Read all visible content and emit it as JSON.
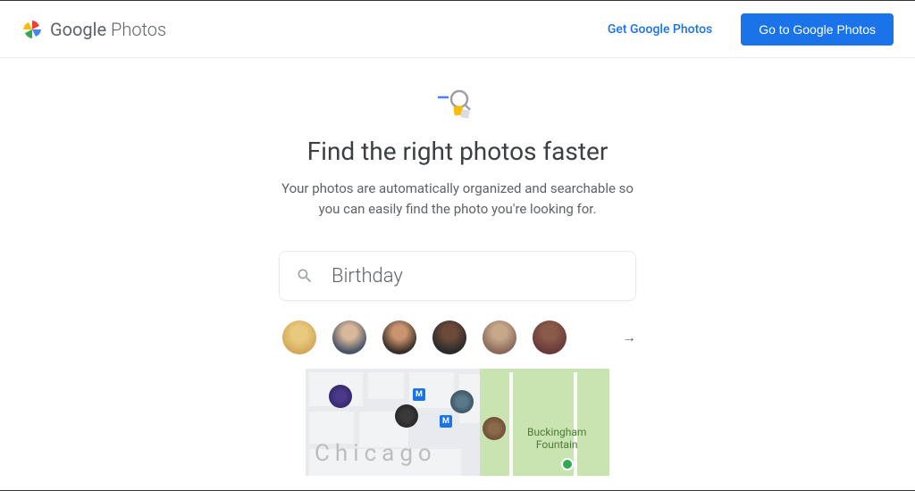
{
  "header": {
    "brand_google": "Google",
    "brand_photos": " Photos",
    "get_link": "Get Google Photos",
    "go_button": "Go to Google Photos"
  },
  "hero": {
    "title": "Find the right photos faster",
    "subtitle": "Your photos are automatically organized and searchable so you can easily find the photo you're looking for."
  },
  "search": {
    "query": "Birthday"
  },
  "avatars": [
    {
      "name": "dog",
      "bg": "radial-gradient(circle at 50% 40%, #e8c97d 30%, #d4a85a 70%)"
    },
    {
      "name": "person-1",
      "bg": "radial-gradient(circle at 50% 35%, #d8b89a 25%, #4a5468 70%)"
    },
    {
      "name": "person-2",
      "bg": "radial-gradient(circle at 50% 35%, #c9946f 25%, #3a2f28 70%)"
    },
    {
      "name": "person-3",
      "bg": "radial-gradient(circle at 50% 35%, #6b4a3a 25%, #2a2a2a 70%)"
    },
    {
      "name": "person-4",
      "bg": "radial-gradient(circle at 50% 35%, #c8a88a 25%, #8a6a5a 70%)"
    },
    {
      "name": "person-5",
      "bg": "radial-gradient(circle at 50% 35%, #8a5a4a 25%, #6a3a3a 70%)"
    }
  ],
  "map": {
    "city_label": "Chicago",
    "park_label_1": "Buckingham",
    "park_label_2": "Fountain",
    "marker_text": "M"
  }
}
